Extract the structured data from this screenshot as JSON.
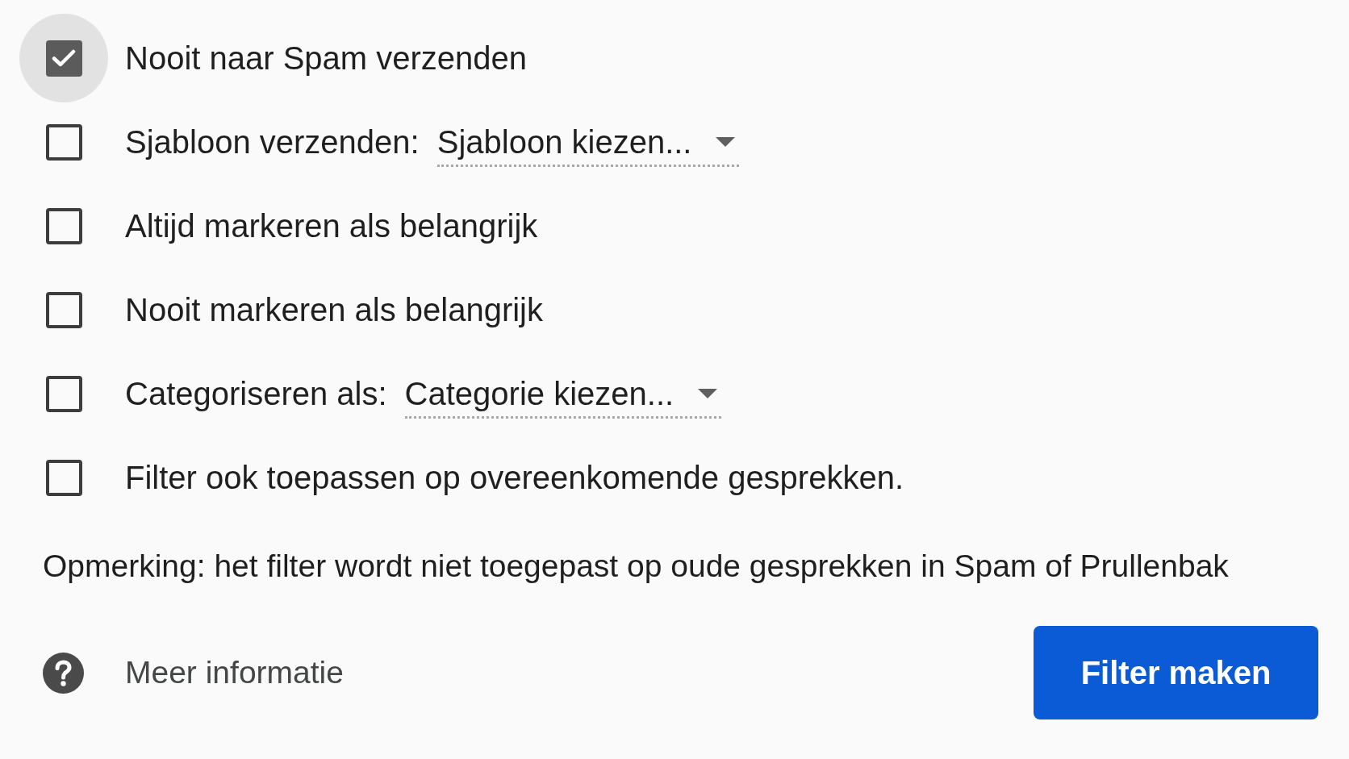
{
  "actions": [
    {
      "kind": "checkbox",
      "label": "Nooit naar Spam verzenden",
      "checked": true,
      "focused": true
    },
    {
      "kind": "select",
      "label": "Sjabloon verzenden:",
      "value": "Sjabloon kiezen...",
      "checked": false,
      "focused": false
    },
    {
      "kind": "checkbox",
      "label": "Altijd markeren als belangrijk",
      "checked": false,
      "focused": false
    },
    {
      "kind": "checkbox",
      "label": "Nooit markeren als belangrijk",
      "checked": false,
      "focused": false
    },
    {
      "kind": "select",
      "label": "Categoriseren als:",
      "value": "Categorie kiezen...",
      "checked": false,
      "focused": false
    },
    {
      "kind": "checkbox",
      "label": "Filter ook toepassen op overeenkomende gesprekken.",
      "checked": false,
      "focused": false
    }
  ],
  "note": "Opmerking: het filter wordt niet toegepast op oude gesprekken in Spam of Prullenbak",
  "help_link": {
    "label": "Meer informatie"
  },
  "submit_button": {
    "label": "Filter maken"
  }
}
